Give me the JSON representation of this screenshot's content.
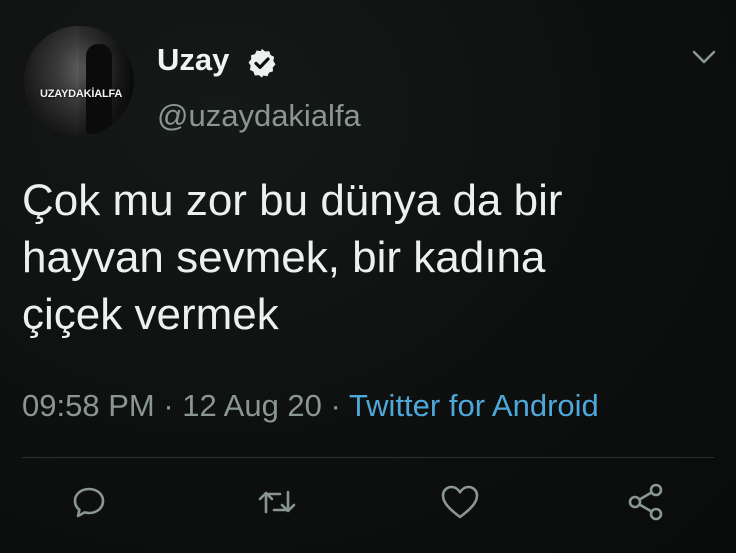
{
  "colors": {
    "background": "#0d100f",
    "primary_text": "#eef0ef",
    "secondary_text": "#8a9691",
    "link": "#4fa6d8",
    "icon": "#8a9691"
  },
  "author": {
    "display_name": "Uzay",
    "handle": "@uzaydakialfa",
    "verified": true,
    "avatar_text": "UZAYDAKİALFA"
  },
  "tweet": {
    "text": "Çok mu zor bu dünya da bir\nhayvan sevmek, bir kadına\nçiçek vermek",
    "time": "09:58 PM",
    "separator": "·",
    "date": "12 Aug 20",
    "source": "Twitter for Android"
  },
  "icons": {
    "menu": "chevron-down-icon",
    "reply": "reply-icon",
    "retweet": "retweet-icon",
    "like": "heart-icon",
    "share": "share-icon",
    "verified": "verified-badge-icon"
  }
}
